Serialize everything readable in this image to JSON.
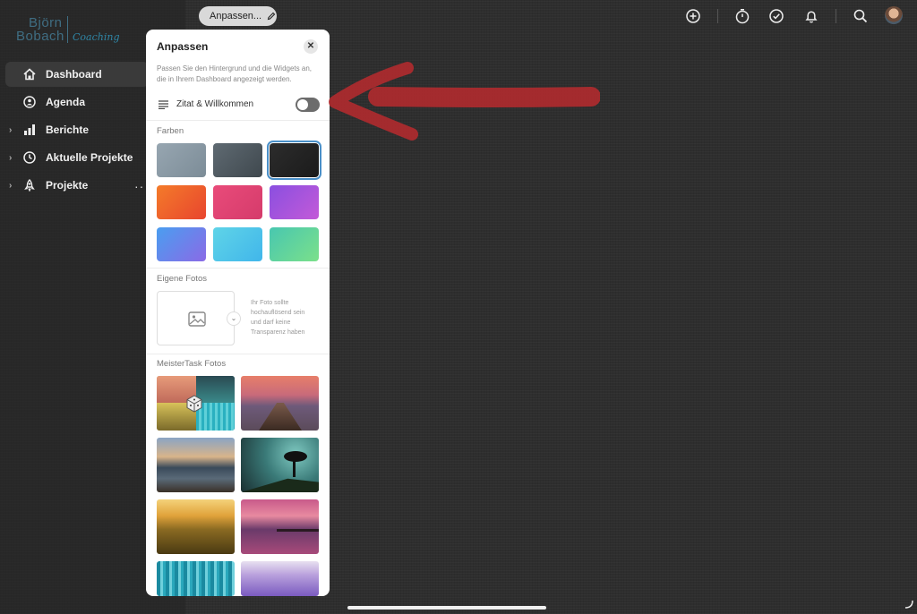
{
  "logo": {
    "line1": "Björn",
    "line2": "Bobach",
    "tagline": "Coaching"
  },
  "sidebar": {
    "items": [
      {
        "label": "Dashboard",
        "icon": "home-icon",
        "active": true,
        "expandable": false
      },
      {
        "label": "Agenda",
        "icon": "agenda-icon",
        "active": false,
        "expandable": false
      },
      {
        "label": "Berichte",
        "icon": "bar-chart-icon",
        "active": false,
        "expandable": true
      },
      {
        "label": "Aktuelle Projekte",
        "icon": "clock-icon",
        "active": false,
        "expandable": true
      },
      {
        "label": "Projekte",
        "icon": "rocket-icon",
        "active": false,
        "expandable": true
      }
    ],
    "more": "···"
  },
  "topbar": {
    "customize_label": "Anpassen...",
    "icons": [
      "add-icon",
      "timer-icon",
      "check-icon",
      "bell-icon",
      "search-icon",
      "avatar"
    ]
  },
  "panel": {
    "title": "Anpassen",
    "close": "✕",
    "description": "Passen Sie den Hintergrund und die Widgets an, die in Ihrem Dashboard angezeigt werden.",
    "quote_toggle": {
      "label": "Zitat & Willkommen",
      "on": false
    },
    "colors_heading": "Farben",
    "colors": [
      {
        "gradient": [
          "#97a6b1",
          "#7c8c97"
        ],
        "selected": false
      },
      {
        "gradient": [
          "#5f6a72",
          "#3f484e"
        ],
        "selected": false
      },
      {
        "gradient": [
          "#2c2c2c",
          "#1b1b1b"
        ],
        "selected": true
      },
      {
        "gradient": [
          "#f47b2a",
          "#e8452e"
        ],
        "selected": false
      },
      {
        "gradient": [
          "#e94b7a",
          "#d53b6b"
        ],
        "selected": false
      },
      {
        "gradient": [
          "#8a4fe0",
          "#c35ad8"
        ],
        "selected": false
      },
      {
        "gradient": [
          "#4a9ef0",
          "#8a6ae6"
        ],
        "selected": false
      },
      {
        "gradient": [
          "#5fd4e8",
          "#41b6ea"
        ],
        "selected": false
      },
      {
        "gradient": [
          "#48c7b0",
          "#7be08a"
        ],
        "selected": false
      }
    ],
    "own_photos_heading": "Eigene Fotos",
    "upload_hint": "Ihr Foto sollte hochauflösend sein und darf keine Transparenz haben",
    "meistertask_heading": "MeisterTask Fotos",
    "photos": [
      "random-photo",
      "pier-sunset",
      "mountain-lake",
      "tree-silhouette",
      "wheat-field",
      "pier-purple",
      "forest-blue",
      "lavender"
    ]
  },
  "annotation": {
    "arrow_color": "#b82a2e"
  }
}
